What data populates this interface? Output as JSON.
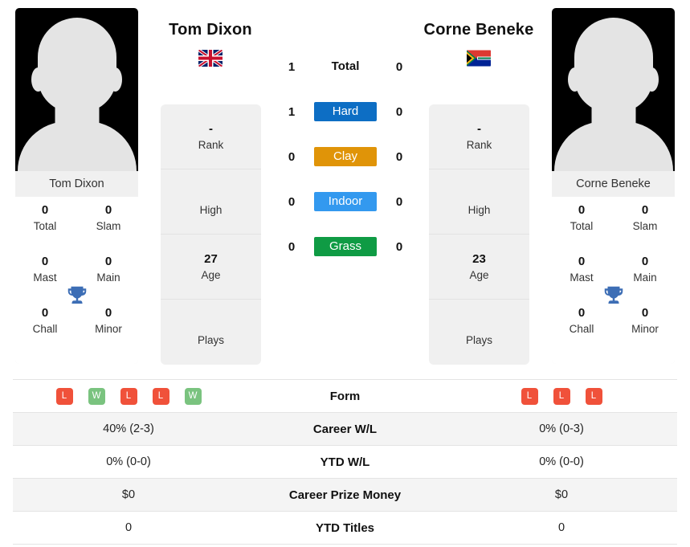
{
  "players": {
    "left": {
      "name": "Tom Dixon",
      "photo_caption": "Tom Dixon",
      "flag": "gb-flag",
      "titles": [
        {
          "value": "0",
          "label": "Total"
        },
        {
          "value": "0",
          "label": "Slam"
        },
        {
          "value": "0",
          "label": "Mast"
        },
        {
          "value": "0",
          "label": "Main"
        },
        {
          "value": "0",
          "label": "Chall"
        },
        {
          "value": "0",
          "label": "Minor"
        }
      ],
      "info": [
        {
          "value": "-",
          "label": "Rank"
        },
        {
          "value": "",
          "label": "High"
        },
        {
          "value": "27",
          "label": "Age"
        },
        {
          "value": "",
          "label": "Plays"
        }
      ],
      "surface_wins": {
        "total": "1",
        "hard": "1",
        "clay": "0",
        "indoor": "0",
        "grass": "0"
      },
      "form": [
        "L",
        "W",
        "L",
        "L",
        "W"
      ],
      "career_wl": "40% (2-3)",
      "ytd_wl": "0% (0-0)",
      "career_prize_money": "$0",
      "ytd_titles": "0"
    },
    "right": {
      "name": "Corne Beneke",
      "photo_caption": "Corne Beneke",
      "flag": "za-flag",
      "titles": [
        {
          "value": "0",
          "label": "Total"
        },
        {
          "value": "0",
          "label": "Slam"
        },
        {
          "value": "0",
          "label": "Mast"
        },
        {
          "value": "0",
          "label": "Main"
        },
        {
          "value": "0",
          "label": "Chall"
        },
        {
          "value": "0",
          "label": "Minor"
        }
      ],
      "info": [
        {
          "value": "-",
          "label": "Rank"
        },
        {
          "value": "",
          "label": "High"
        },
        {
          "value": "23",
          "label": "Age"
        },
        {
          "value": "",
          "label": "Plays"
        }
      ],
      "surface_wins": {
        "total": "0",
        "hard": "0",
        "clay": "0",
        "indoor": "0",
        "grass": "0"
      },
      "form": [
        "L",
        "L",
        "L"
      ],
      "career_wl": "0% (0-3)",
      "ytd_wl": "0% (0-0)",
      "career_prize_money": "$0",
      "ytd_titles": "0"
    }
  },
  "surfaces": [
    {
      "key": "total",
      "label": "Total",
      "color": "transparent"
    },
    {
      "key": "hard",
      "label": "Hard",
      "color": "#0d6ec4"
    },
    {
      "key": "clay",
      "label": "Clay",
      "color": "#e09408"
    },
    {
      "key": "indoor",
      "label": "Indoor",
      "color": "#3399ef"
    },
    {
      "key": "grass",
      "label": "Grass",
      "color": "#0f9b44"
    }
  ],
  "table": {
    "rows": [
      {
        "label": "Form",
        "key": "form"
      },
      {
        "label": "Career W/L",
        "key": "career_wl"
      },
      {
        "label": "YTD W/L",
        "key": "ytd_wl"
      },
      {
        "label": "Career Prize Money",
        "key": "career_prize_money"
      },
      {
        "label": "YTD Titles",
        "key": "ytd_titles"
      }
    ]
  },
  "colors": {
    "win": "#7ac37f",
    "loss": "#f0513a",
    "trophy": "#3d6eb5",
    "card_bg": "#f0f0f0"
  }
}
